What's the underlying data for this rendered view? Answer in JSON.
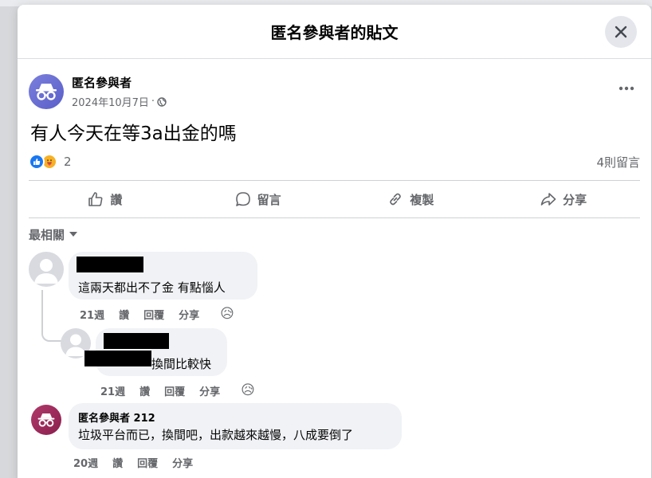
{
  "dialog": {
    "title": "匿名參與者的貼文"
  },
  "post": {
    "author": "匿名參與者",
    "date": "2024年10月7日",
    "meta_sep": "·",
    "body": "有人今天在等3a出金的嗎",
    "reaction_count": "2",
    "comment_count": "4則留言"
  },
  "actions": {
    "like": "讚",
    "comment": "留言",
    "copy": "複製",
    "share": "分享"
  },
  "sort": {
    "label": "最相關"
  },
  "comments": [
    {
      "text": "這兩天都出不了金 有點惱人",
      "time": "21週",
      "like": "讚",
      "reply": "回覆",
      "share": "分享",
      "reaction": "😥"
    },
    {
      "text_visible": "換間比較快",
      "time": "21週",
      "like": "讚",
      "reply": "回覆",
      "share": "分享",
      "reaction": "😥"
    },
    {
      "author": "匿名參與者 212",
      "text": "垃圾平台而已，換間吧，出款越來越慢，八成要倒了",
      "time": "20週",
      "like": "讚",
      "reply": "回覆",
      "share": "分享"
    }
  ],
  "colors": {
    "accent": "#1877f2",
    "muted_text": "#65676b",
    "bubble": "#f0f2f5",
    "anon_avatar": "#6a6ed2",
    "anon_avatar_2": "#9c2c5c"
  },
  "icons": {
    "close": "close-icon",
    "more": "more-horizontal-icon",
    "globe": "globe-icon",
    "like": "thumbs-up-icon",
    "comment": "comment-bubble-icon",
    "copy": "link-icon",
    "share": "share-arrow-icon",
    "sort": "chevron-down-icon",
    "anon": "incognito-icon",
    "user": "default-user-icon"
  }
}
